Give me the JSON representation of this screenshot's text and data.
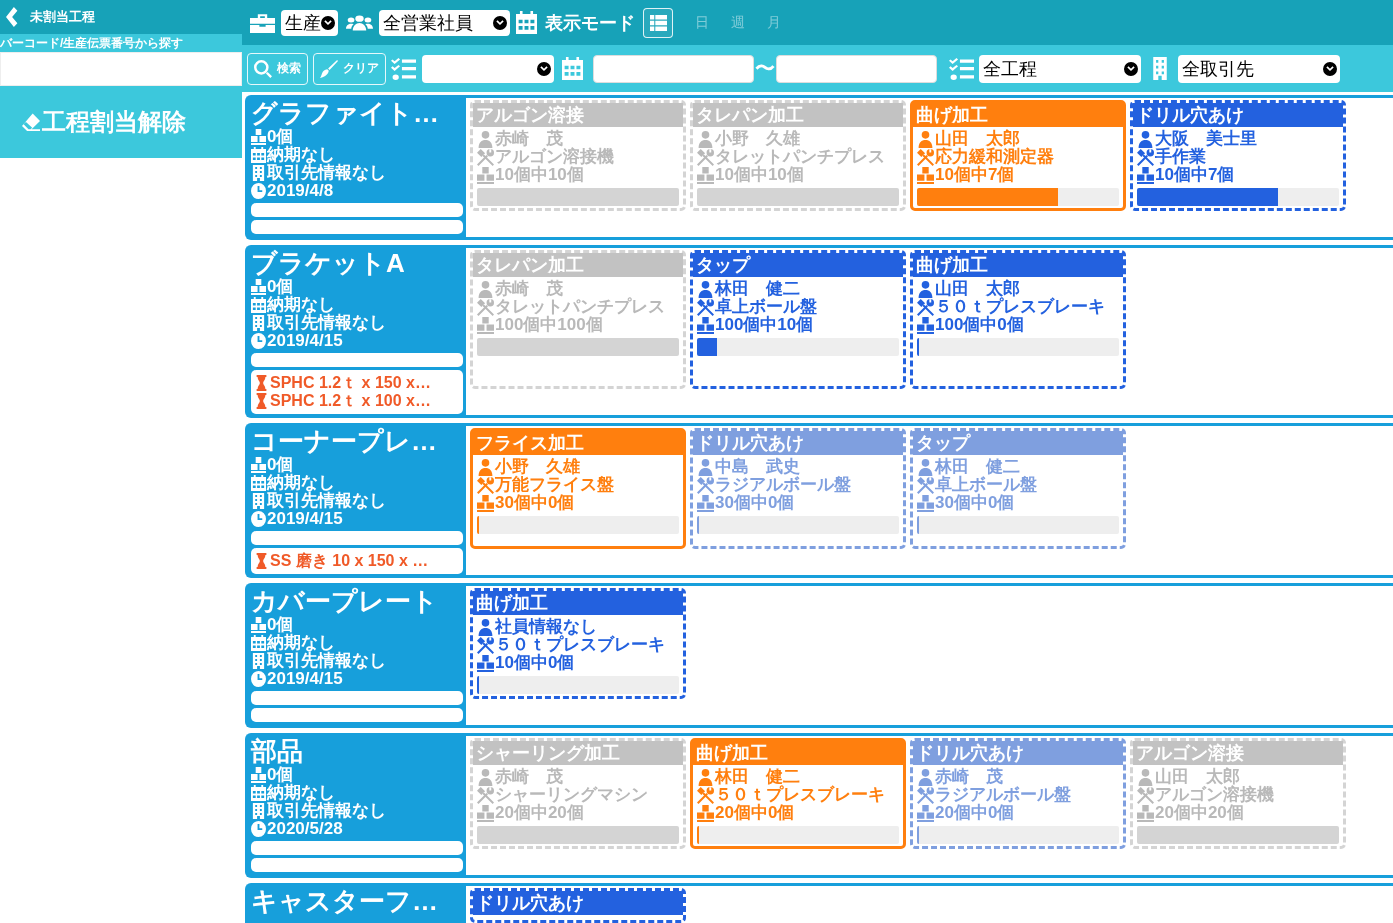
{
  "sidebar": {
    "back_label": "未割当工程",
    "search_label": "バーコード/生産伝票番号から探す",
    "unassign_button": "工程割当解除"
  },
  "toolbar": {
    "department": {
      "value": "生産"
    },
    "staff": {
      "value": "全営業社員"
    },
    "view_mode_label": "表示モード",
    "view_modes": [
      {
        "kind": "icon",
        "selected": true
      },
      {
        "kind": "text",
        "label": "日",
        "selected": false
      },
      {
        "kind": "text",
        "label": "週",
        "selected": false
      },
      {
        "kind": "text",
        "label": "月",
        "selected": false
      }
    ]
  },
  "filters": {
    "buttons": [
      {
        "kind": "search",
        "label": "検索"
      },
      {
        "kind": "clear",
        "label": "クリア"
      }
    ],
    "date_separator": "〜",
    "process": {
      "value": "全工程"
    },
    "customer": {
      "value": "全取引先"
    }
  },
  "products": [
    {
      "name": "グラファイト…",
      "quantity": "0個",
      "due": "納期なし",
      "customer": "取引先情報なし",
      "date": "2019/4/8",
      "processes": [
        {
          "name": "アルゴン溶接",
          "kind": "done",
          "worker": "赤崎　茂",
          "machine": "アルゴン溶接機",
          "progress": "10個中10個",
          "level": 1
        },
        {
          "name": "タレパン加工",
          "kind": "done",
          "worker": "小野　久雄",
          "machine": "タレットパンチプレス",
          "progress": "10個中10個",
          "level": 1
        },
        {
          "name": "曲げ加工",
          "kind": "working",
          "worker": "山田　太郎",
          "machine": "応力緩和測定器",
          "progress": "10個中7個",
          "level": 0.7
        },
        {
          "name": "ドリル穴あけ",
          "kind": "next",
          "worker": "大阪　美士里",
          "machine": "手作業",
          "progress": "10個中7個",
          "level": 0.7
        }
      ]
    },
    {
      "name": "ブラケットA",
      "quantity": "0個",
      "due": "納期なし",
      "customer": "取引先情報なし",
      "date": "2019/4/15",
      "materials": [
        "SPHC 1.2ｔ x 150 x…",
        "SPHC 1.2ｔ x 100 x…"
      ],
      "processes": [
        {
          "name": "タレパン加工",
          "kind": "done",
          "worker": "赤崎　茂",
          "machine": "タレットパンチプレス",
          "progress": "100個中100個",
          "level": 1
        },
        {
          "name": "タップ",
          "kind": "next",
          "worker": "林田　健二",
          "machine": "卓上ボール盤",
          "progress": "100個中10個",
          "level": 0.1
        },
        {
          "name": "曲げ加工",
          "kind": "next",
          "worker": "山田　太郎",
          "machine": "５０ｔプレスブレーキ",
          "progress": "100個中0個",
          "level": 0
        }
      ]
    },
    {
      "name": "コーナープレ…",
      "quantity": "0個",
      "due": "納期なし",
      "customer": "取引先情報なし",
      "date": "2019/4/15",
      "materials": [
        "SS 磨き 10 x 150 x …"
      ],
      "processes": [
        {
          "name": "フライス加工",
          "kind": "working",
          "worker": "小野　久雄",
          "machine": "万能フライス盤",
          "progress": "30個中0個",
          "level": 0
        },
        {
          "name": "ドリル穴あけ",
          "kind": "queued",
          "worker": "中島　武史",
          "machine": "ラジアルボール盤",
          "progress": "30個中0個",
          "level": 0
        },
        {
          "name": "タップ",
          "kind": "queued",
          "worker": "林田　健二",
          "machine": "卓上ボール盤",
          "progress": "30個中0個",
          "level": 0
        }
      ]
    },
    {
      "name": "カバープレート",
      "quantity": "0個",
      "due": "納期なし",
      "customer": "取引先情報なし",
      "date": "2019/4/15",
      "processes": [
        {
          "name": "曲げ加工",
          "kind": "next",
          "worker": "社員情報なし",
          "machine": "５０ｔプレスブレーキ",
          "progress": "10個中0個",
          "level": 0
        }
      ]
    },
    {
      "name": "部品",
      "quantity": "0個",
      "due": "納期なし",
      "customer": "取引先情報なし",
      "date": "2020/5/28",
      "processes": [
        {
          "name": "シャーリング加工",
          "kind": "done",
          "worker": "赤崎　茂",
          "machine": "シャーリングマシン",
          "progress": "20個中20個",
          "level": 1
        },
        {
          "name": "曲げ加工",
          "kind": "working",
          "worker": "林田　健二",
          "machine": "５０ｔプレスブレーキ",
          "progress": "20個中0個",
          "level": 0
        },
        {
          "name": "ドリル穴あけ",
          "kind": "queued",
          "worker": "赤崎　茂",
          "machine": "ラジアルボール盤",
          "progress": "20個中0個",
          "level": 0
        },
        {
          "name": "アルゴン溶接",
          "kind": "done",
          "worker": "山田　太郎",
          "machine": "アルゴン溶接機",
          "progress": "20個中20個",
          "level": 1
        }
      ]
    },
    {
      "name": "キャスターフ…",
      "processes": [
        {
          "name": "ドリル穴あけ",
          "kind": "next"
        }
      ]
    }
  ]
}
